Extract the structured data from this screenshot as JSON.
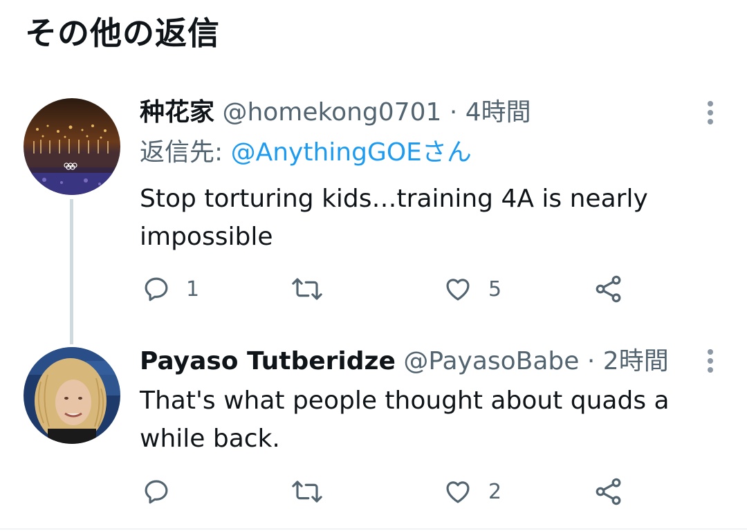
{
  "section_title": "その他の返信",
  "tweets": [
    {
      "display_name": "种花家",
      "handle": "@homekong0701",
      "separator": "·",
      "time": "4時間",
      "reply_label": "返信先:",
      "reply_mention": "@AnythingGOEさん",
      "text": "Stop torturing kids…training 4A is nearly impossible",
      "avatar_icon": "stadium-fireworks-avatar",
      "reply_count": "1",
      "retweet_count": "",
      "like_count": "5"
    },
    {
      "display_name": "Payaso Tutberidze",
      "handle": "@PayasoBabe",
      "separator": "·",
      "time": "2時間",
      "text": "That's what people thought about quads a while back.",
      "avatar_icon": "blonde-woman-avatar",
      "reply_count": "",
      "retweet_count": "",
      "like_count": "2"
    }
  ],
  "colors": {
    "accent": "#1d9bf0",
    "secondary_text": "#536471",
    "primary_text": "#0f1419",
    "thread_line": "#cfd9de"
  },
  "icons": [
    "reply-icon",
    "retweet-icon",
    "like-icon",
    "share-icon",
    "more-icon"
  ]
}
